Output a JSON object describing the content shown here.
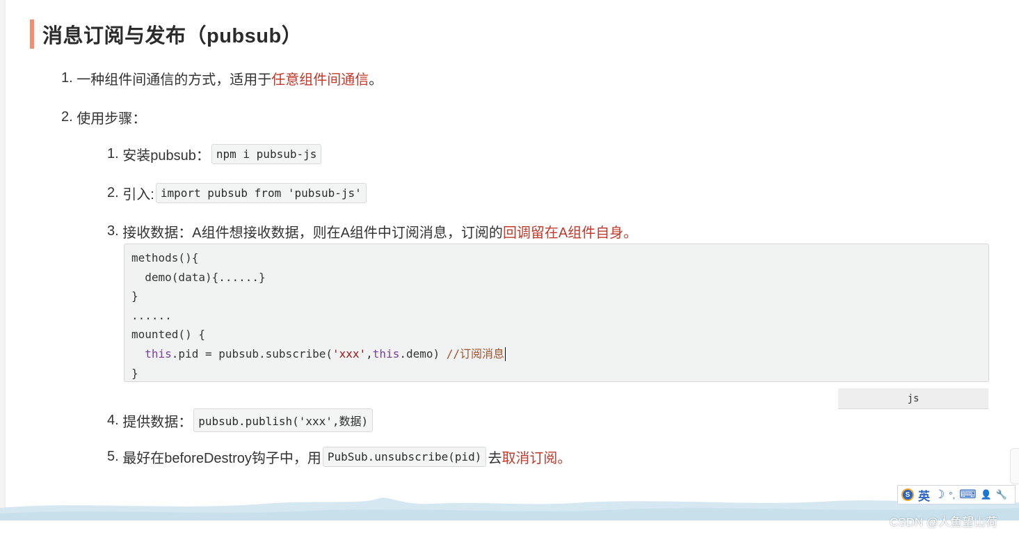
{
  "heading": "消息订阅与发布（pubsub）",
  "items": {
    "i1": {
      "num": "1.",
      "text_a": "一种组件间通信的方式，适用于",
      "text_red": "任意组件间通信",
      "text_b": "。"
    },
    "i2": {
      "num": "2.",
      "text": "使用步骤："
    }
  },
  "steps": {
    "s1": {
      "num": "1.",
      "text": "安装pubsub：",
      "code": "npm i pubsub-js"
    },
    "s2": {
      "num": "2.",
      "text": "引入:",
      "code": "import pubsub from 'pubsub-js'"
    },
    "s3": {
      "num": "3.",
      "text_a": "接收数据：A组件想接收数据，则在A组件中订阅消息，订阅的",
      "text_red": "回调留在A组件自身。"
    },
    "s4": {
      "num": "4.",
      "text": "提供数据：",
      "code": "pubsub.publish('xxx',数据)"
    },
    "s5": {
      "num": "5.",
      "text_a": "最好在beforeDestroy钩子中，用",
      "code": "PubSub.unsubscribe(pid)",
      "text_b": "去",
      "text_red": "取消订阅。"
    }
  },
  "codeblock": {
    "l1": "methods(){",
    "l2": "  demo(data){......}",
    "l3": "}",
    "l4": "......",
    "l5": "mounted() {",
    "l6_indent": "  ",
    "l6_kw1": "this",
    "l6_mid": ".pid = pubsub.subscribe(",
    "l6_str": "'xxx'",
    "l6_comma": ",",
    "l6_kw2": "this",
    "l6_end": ".demo) ",
    "l6_comment": "//订阅消息",
    "l7": "}",
    "language": "js"
  },
  "ime": {
    "label": "英",
    "moon": "☽",
    "punct": "°,",
    "keyboard": "⌨",
    "user": "👤",
    "tool": "🔧"
  },
  "watermark": "CSDN @人鱼望山荷"
}
